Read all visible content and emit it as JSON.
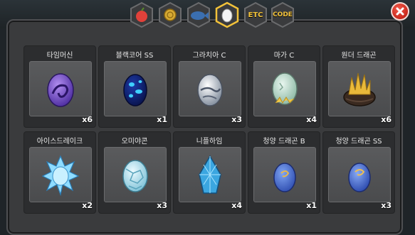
{
  "tabs": [
    {
      "icon": "fruit-icon"
    },
    {
      "icon": "coin-icon"
    },
    {
      "icon": "fish-icon"
    },
    {
      "icon": "egg-icon",
      "active": true
    },
    {
      "label": "ETC"
    },
    {
      "label": "CODE"
    }
  ],
  "items": [
    {
      "name": "타임머신",
      "qty": "x6"
    },
    {
      "name": "블랙코어 SS",
      "qty": "x1"
    },
    {
      "name": "그라치아 C",
      "qty": "x3"
    },
    {
      "name": "마가 C",
      "qty": "x4"
    },
    {
      "name": "원더 드래곤",
      "qty": "x6"
    },
    {
      "name": "아이스드레이크",
      "qty": "x2"
    },
    {
      "name": "오미야콘",
      "qty": "x3"
    },
    {
      "name": "니플하임",
      "qty": "x4"
    },
    {
      "name": "청양 드래곤 B",
      "qty": "x1"
    },
    {
      "name": "청양 드래곤 SS",
      "qty": "x3"
    }
  ],
  "colors": {
    "accent_gold": "#f2c23a",
    "close_red": "#c9281c"
  }
}
